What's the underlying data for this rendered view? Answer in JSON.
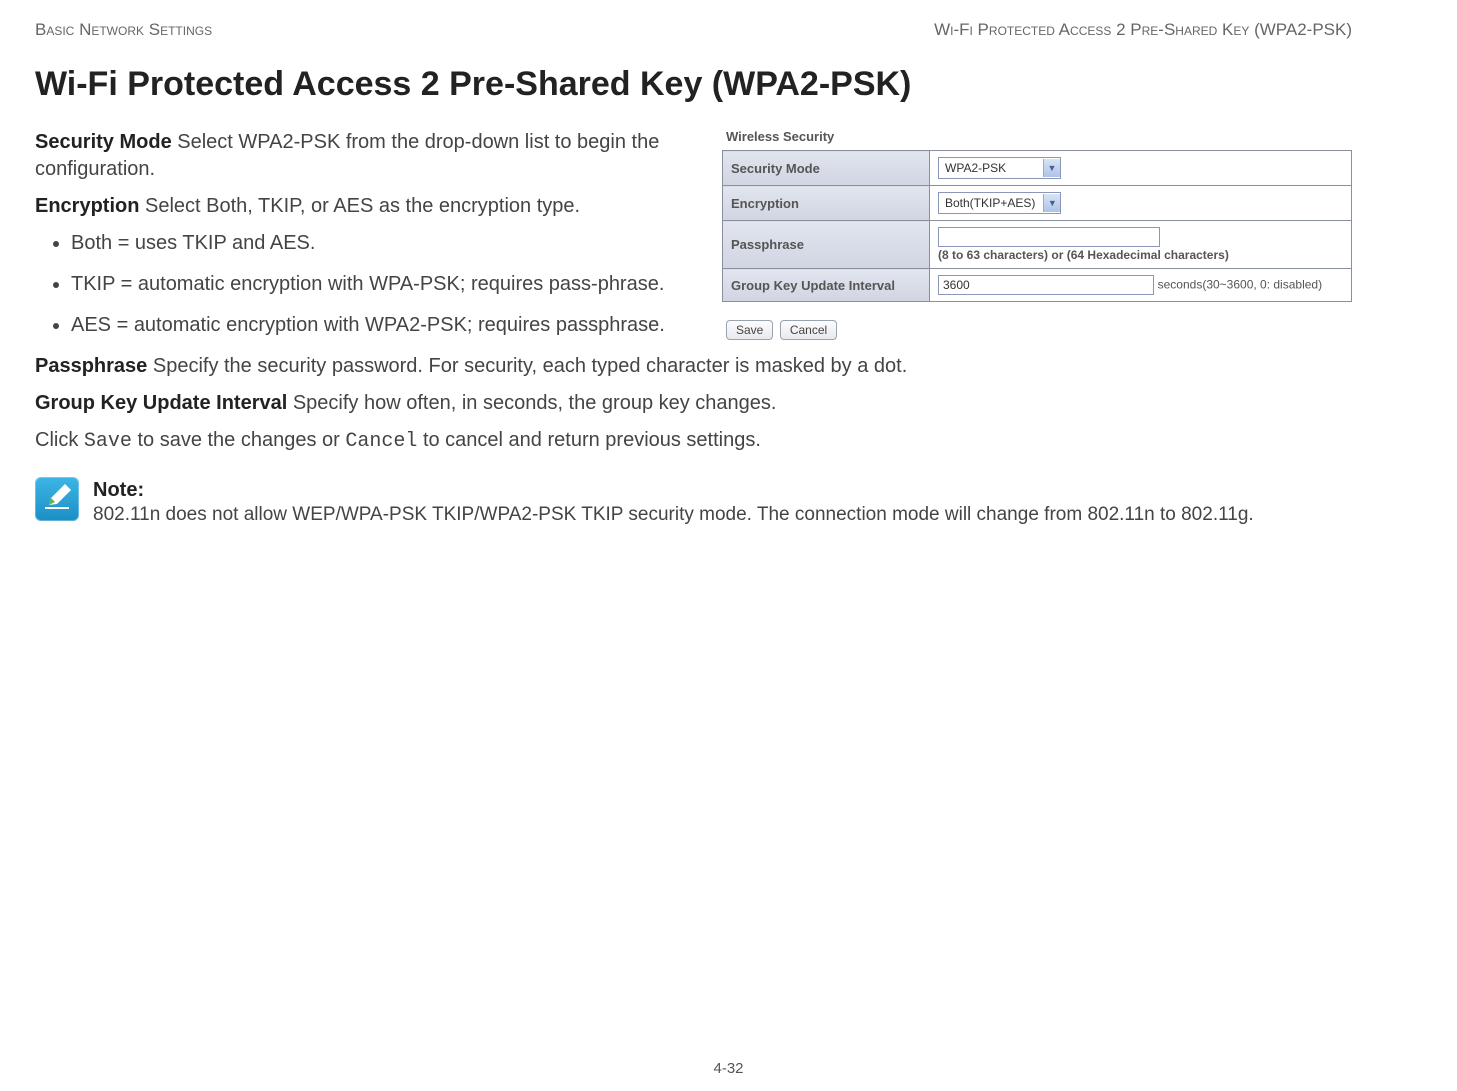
{
  "header": {
    "left": "Basic Network Settings",
    "right": "Wi-Fi Protected Access 2 Pre-Shared Key (WPA2-PSK)"
  },
  "title": "Wi-Fi Protected Access 2 Pre-Shared Key (WPA2-PSK)",
  "figure": {
    "caption": "Wireless Security",
    "rows": {
      "security_mode": {
        "label": "Security Mode",
        "value": "WPA2-PSK"
      },
      "encryption": {
        "label": "Encryption",
        "value": "Both(TKIP+AES)"
      },
      "passphrase": {
        "label": "Passphrase",
        "value": "",
        "hint": "(8 to 63 characters) or (64 Hexadecimal characters)"
      },
      "group_key": {
        "label": "Group Key Update Interval",
        "value": "3600",
        "hint": "seconds(30~3600, 0: disabled)"
      }
    },
    "buttons": {
      "save": "Save",
      "cancel": "Cancel"
    }
  },
  "body": {
    "security_mode": {
      "term": "Security Mode",
      "text": "  Select WPA2-PSK from the drop-down list to begin the configuration."
    },
    "encryption": {
      "term": "Encryption",
      "text": "  Select Both, TKIP, or AES as the encryption type."
    },
    "bullets": [
      "Both = uses TKIP and AES.",
      "TKIP = automatic encryption with WPA-PSK; requires pass-phrase.",
      "AES = automatic encryption with WPA2-PSK; requires passphrase."
    ],
    "passphrase": {
      "term": "Passphrase",
      "text": "  Specify the security password. For security, each typed character is masked by a dot."
    },
    "group_key": {
      "term": "Group Key Update Interval",
      "text": "  Specify how often, in seconds, the group key changes."
    },
    "closing": {
      "pre": "Click ",
      "save": "Save",
      "mid": " to save the changes or ",
      "cancel": "Cancel",
      "post": " to cancel and return previous settings."
    }
  },
  "note": {
    "label": "Note:",
    "text": "802.11n does not allow WEP/WPA-PSK TKIP/WPA2-PSK TKIP security mode. The connection mode will change from 802.11n to 802.11g."
  },
  "footer": "4-32"
}
